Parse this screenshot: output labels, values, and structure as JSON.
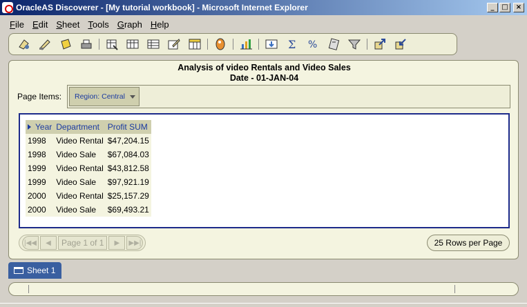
{
  "window": {
    "title": "OracleAS Discoverer - [My tutorial workbook] - Microsoft Internet Explorer",
    "controls": {
      "minimize": "_",
      "maximize": "□",
      "close": "×"
    }
  },
  "menu": [
    {
      "label": "File"
    },
    {
      "label": "Edit"
    },
    {
      "label": "Sheet"
    },
    {
      "label": "Tools"
    },
    {
      "label": "Graph"
    },
    {
      "label": "Help"
    }
  ],
  "toolbar": {
    "icons": [
      "open-workbook-icon",
      "edit-icon",
      "save-icon",
      "print-icon",
      "table-layout-icon",
      "table-icon",
      "crosstab-icon",
      "edit-sheet-icon",
      "page-items-icon",
      "color-palette-icon",
      "graph-icon",
      "drill-icon",
      "sum-icon",
      "percent-icon",
      "calculator-icon",
      "filter-icon",
      "export-icon",
      "import-icon"
    ]
  },
  "report": {
    "title_line1": "Analysis of video Rentals and Video Sales",
    "title_line2": "Date - 01-JAN-04",
    "page_items_label": "Page Items:",
    "region_selector": "Region:  Central"
  },
  "table": {
    "columns": [
      "Year",
      "Department",
      "Profit SUM"
    ],
    "rows": [
      [
        "1998",
        "Video Rental",
        "$47,204.15"
      ],
      [
        "1998",
        "Video Sale",
        "$67,084.03"
      ],
      [
        "1999",
        "Video Rental",
        "$43,812.58"
      ],
      [
        "1999",
        "Video Sale",
        "$97,921.19"
      ],
      [
        "2000",
        "Video Rental",
        "$25,157.29"
      ],
      [
        "2000",
        "Video Sale",
        "$69,493.21"
      ]
    ]
  },
  "pager": {
    "page_label": "Page 1 of 1",
    "rows_per_page": "25 Rows per Page"
  },
  "sheet_tab": {
    "label": "Sheet 1"
  },
  "colors": {
    "title_bar_start": "#0a246a",
    "title_bar_end": "#a6caf0",
    "panel_bg": "#f4f4e0",
    "header_bg": "#cfcfae",
    "header_text": "#1a3aa0",
    "grid_border": "#1c2a8a",
    "sheet_tab": "#3a5fa0"
  }
}
